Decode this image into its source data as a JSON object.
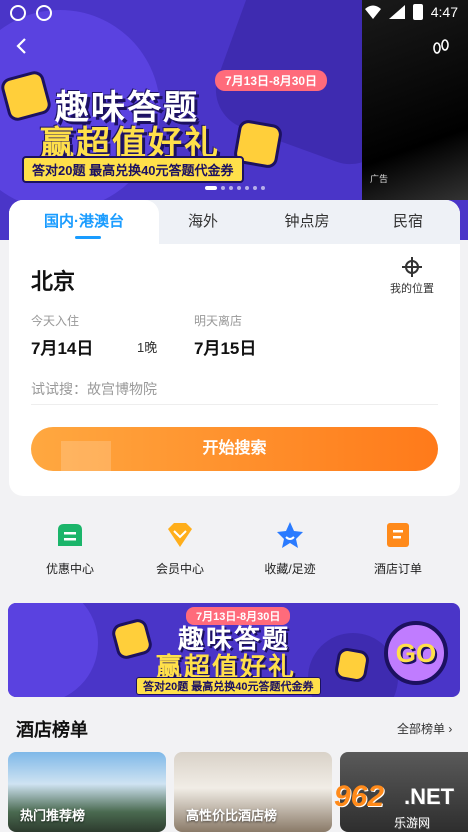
{
  "status_bar": {
    "time": "4:47"
  },
  "hero": {
    "date_range": "7月13日-8月30日",
    "title_line1": "趣味答题",
    "title_line2": "赢超值好礼",
    "subtitle": "答对20题 最高兑换40元答题代金券",
    "ad_label": "广告"
  },
  "tabs": [
    {
      "label": "国内·港澳台"
    },
    {
      "label": "海外"
    },
    {
      "label": "钟点房"
    },
    {
      "label": "民宿"
    }
  ],
  "search": {
    "city": "北京",
    "locate_label": "我的位置",
    "checkin_label": "今天入住",
    "checkin_date": "7月14日",
    "nights": "1晚",
    "checkout_label": "明天离店",
    "checkout_date": "7月15日",
    "hint": "试试搜：故宫博物院",
    "button_label": "开始搜索"
  },
  "quick_links": [
    {
      "label": "优惠中心",
      "icon": "coupon-icon",
      "color": "#1bb56a"
    },
    {
      "label": "会员中心",
      "icon": "diamond-icon",
      "color": "#ffae1a"
    },
    {
      "label": "收藏/足迹",
      "icon": "star-icon",
      "color": "#2a7bff"
    },
    {
      "label": "酒店订单",
      "icon": "order-icon",
      "color": "#ff8a1a"
    }
  ],
  "promo": {
    "date_range": "7月13日-8月30日",
    "title_line1": "趣味答题",
    "title_line2": "赢超值好礼",
    "subtitle": "答对20题 最高兑换40元答题代金券",
    "go_label": "GO"
  },
  "rankings": {
    "title": "酒店榜单",
    "all_label": "全部榜单 ›",
    "cards": [
      {
        "caption": "热门推荐榜"
      },
      {
        "caption": "高性价比酒店榜"
      },
      {
        "caption": ""
      }
    ]
  },
  "watermark": {
    "num": "962",
    "net": ".NET",
    "sub": "乐游网"
  },
  "colors": {
    "accent": "#1a9cff",
    "search_button": "#ff8a1a",
    "banner": "#4a35c8"
  }
}
